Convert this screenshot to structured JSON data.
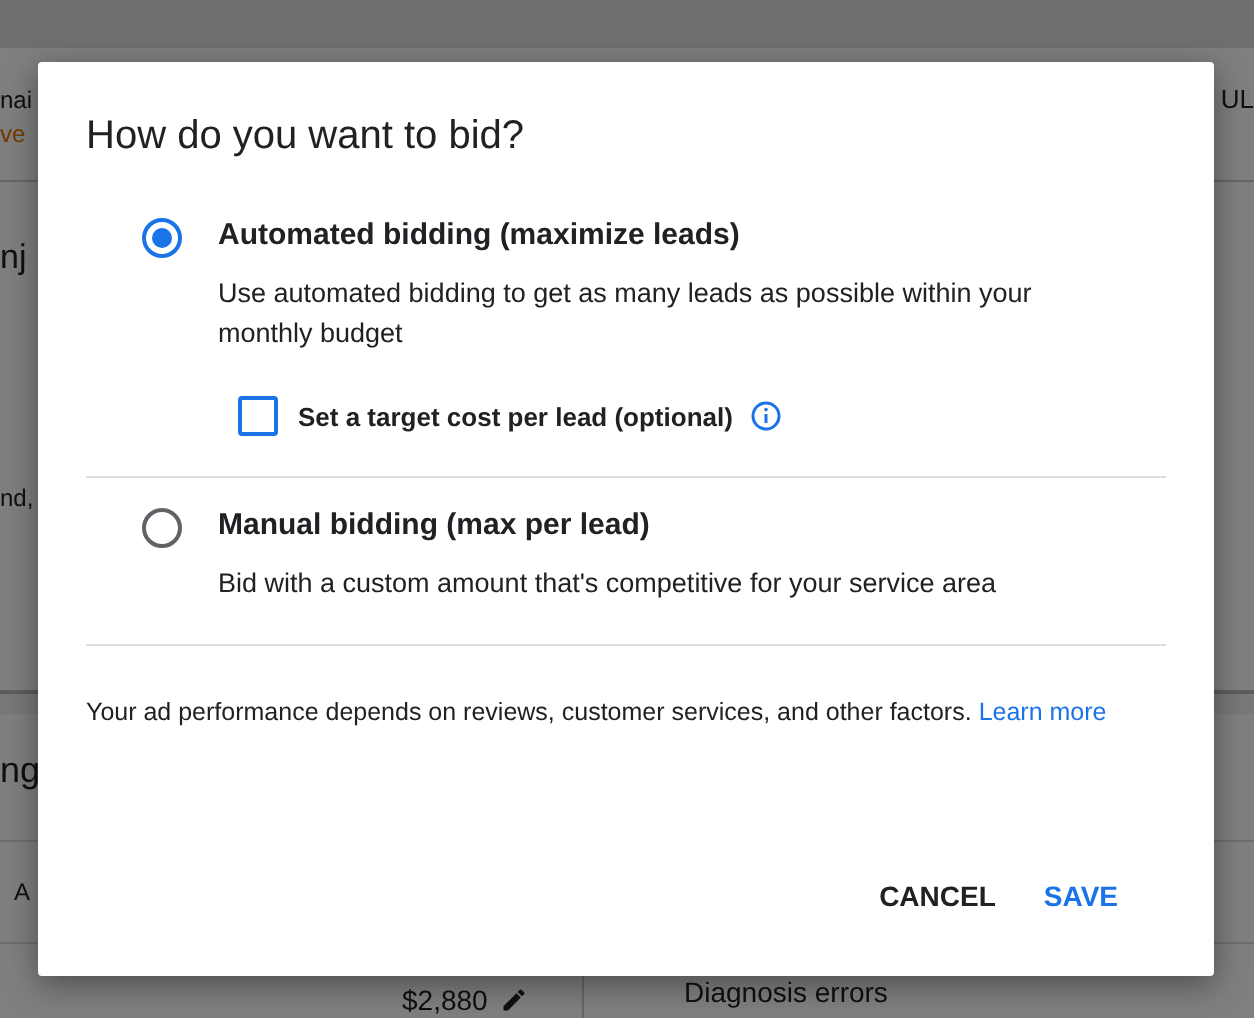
{
  "background": {
    "header_text": "nai",
    "header_warning": "ve",
    "header_right": "UL",
    "section_title": "nj",
    "section_text": "nd,",
    "panel_title": "ng",
    "table_text": "A",
    "amount": "$2,880",
    "diagnosis": "Diagnosis errors"
  },
  "dialog": {
    "title": "How do you want to bid?",
    "options": [
      {
        "label": "Automated bidding (maximize leads)",
        "description": "Use automated bidding to get as many leads as possible within your monthly budget",
        "selected": true,
        "checkbox": {
          "label": "Set a target cost per lead (optional)",
          "checked": false
        }
      },
      {
        "label": "Manual bidding (max per lead)",
        "description": "Bid with a custom amount that's competitive for your service area",
        "selected": false
      }
    ],
    "footer": {
      "text": "Your ad performance depends on reviews, customer services, and other factors.",
      "link": "Learn more"
    },
    "buttons": [
      {
        "label": "CANCEL",
        "kind": "plain"
      },
      {
        "label": "SAVE",
        "kind": "primary"
      }
    ]
  }
}
